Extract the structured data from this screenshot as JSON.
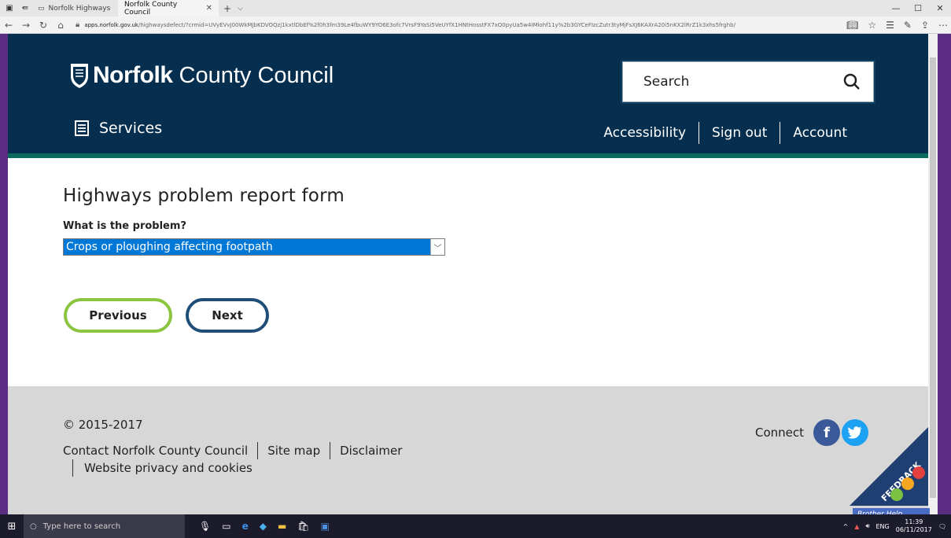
{
  "browser": {
    "tabs": [
      {
        "label": "Norfolk Highways",
        "active": false
      },
      {
        "label": "Norfolk County Council",
        "active": true
      }
    ],
    "url_host": "apps.norfolk.gov.uk",
    "url_rest": "/highwaysdefect/?crmid=UVyEVvJ00WkMJbKDVOQzj1kxtlDbEf%2f0h3fm39Le4fbuWY9YO6E3ofc7VrsF9YaSi5VeUYfX1HNtHosstFX7xO0pyUa5w4IMlohf11y%2b3GYCeFIzcZutr3tyMjFsXJ6KAXrA20i5nKX2lRrZ1k3xhs5frghb/"
  },
  "header": {
    "brand": "Norfolk",
    "brand_rest": "County Council",
    "search_placeholder": "Search",
    "services_label": "Services",
    "util_links": [
      "Accessibility",
      "Sign out",
      "Account"
    ]
  },
  "form": {
    "title": "Highways problem report form",
    "question": "What is the problem?",
    "selected_option": "Crops or ploughing affecting footpath",
    "previous_label": "Previous",
    "next_label": "Next"
  },
  "footer": {
    "copyright": "© 2015-2017",
    "links": [
      "Contact Norfolk County Council",
      "Site map",
      "Disclaimer"
    ],
    "links2": [
      "Website privacy and cookies"
    ],
    "connect_label": "Connect",
    "social": [
      {
        "name": "facebook-icon",
        "glyph": "f"
      },
      {
        "name": "twitter-icon",
        "glyph": "t"
      }
    ]
  },
  "feedback_label": "FEEDBACK",
  "taskbar": {
    "search_placeholder": "Type here to search",
    "tray_lang": "ENG",
    "time": "11:39",
    "date": "06/11/2017",
    "brother_label": "Brother Help"
  },
  "colors": {
    "header_bg": "#062f4f",
    "previous_border": "#8bc540",
    "next_border": "#1f4e79",
    "select_highlight": "#0078d7"
  }
}
